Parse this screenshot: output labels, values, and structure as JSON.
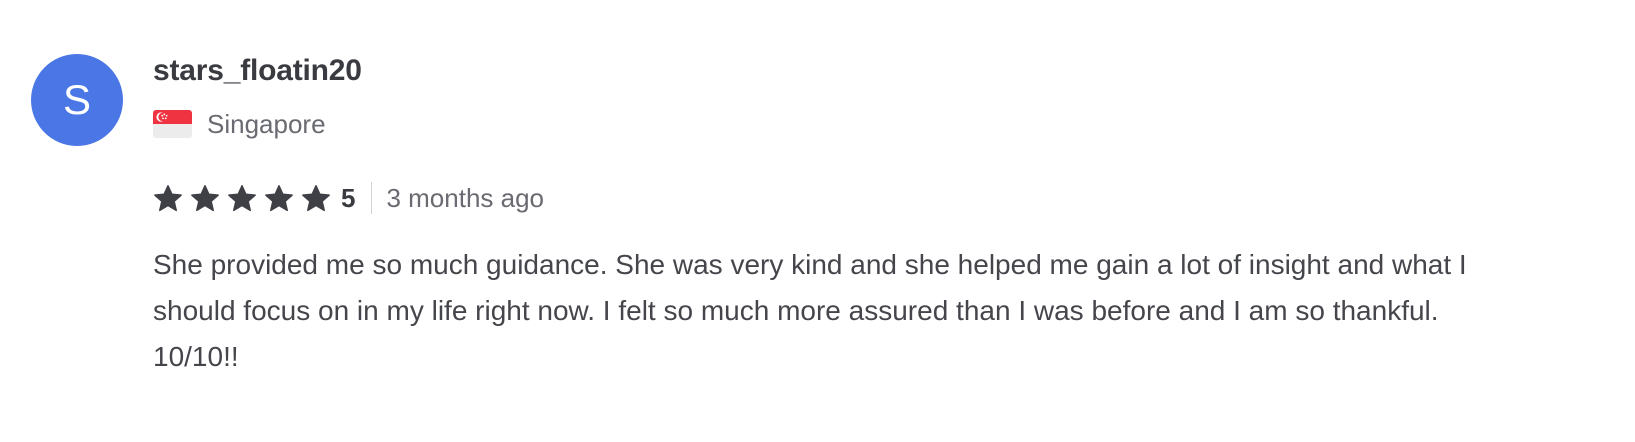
{
  "review": {
    "avatar_initial": "S",
    "avatar_color": "#4a77e5",
    "username": "stars_floatin20",
    "country": "Singapore",
    "flag_icon": "singapore-flag-icon",
    "rating": 5,
    "rating_label": "5",
    "stars_total": 5,
    "star_icon": "star-icon",
    "time_ago": "3 months ago",
    "text": "She provided me so much guidance. She was very kind and she helped me gain a lot of insight and what I should focus on in my life right now. I felt so much more assured than I was before and I am so thankful. 10/10!!"
  }
}
